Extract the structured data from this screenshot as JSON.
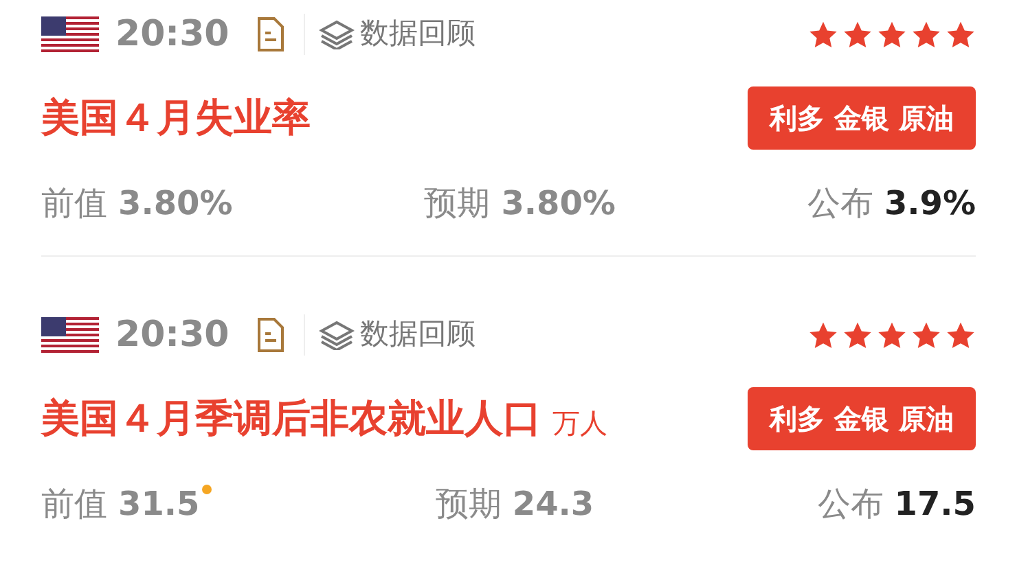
{
  "events": [
    {
      "time": "20:30",
      "review": "数据回顾",
      "stars": 5,
      "title": "美国４月失业率",
      "tag": "利多 金银 原油",
      "values": [
        {
          "label": "前值",
          "value": "3.80%",
          "revised": false,
          "kind": "previous"
        },
        {
          "label": "预期",
          "value": "3.80%",
          "revised": false,
          "kind": "forecast"
        },
        {
          "label": "公布",
          "value": "3.9%",
          "revised": false,
          "kind": "actual"
        }
      ]
    },
    {
      "time": "20:30",
      "review": "数据回顾",
      "stars": 5,
      "title": "美国４月季调后非农就业人口",
      "unit": "万人",
      "tag": "利多 金银 原油",
      "values": [
        {
          "label": "前值",
          "value": "31.5",
          "revised": true,
          "kind": "previous"
        },
        {
          "label": "预期",
          "value": "24.3",
          "revised": false,
          "kind": "forecast"
        },
        {
          "label": "公布",
          "value": "17.5",
          "revised": false,
          "kind": "actual"
        }
      ]
    }
  ]
}
